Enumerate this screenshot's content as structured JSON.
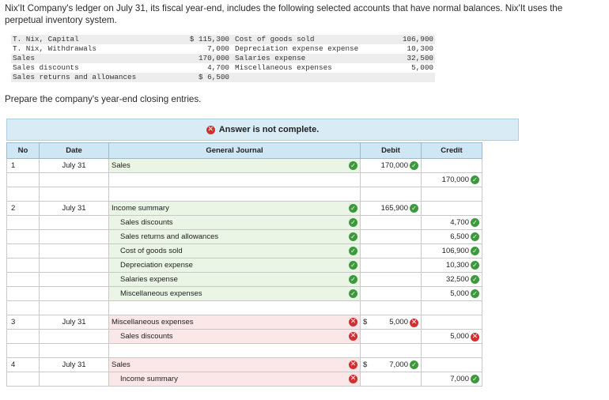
{
  "intro": "Nix'It Company's ledger on July 31, its fiscal year-end, includes the following selected accounts that have normal balances. Nix'It uses the perpetual inventory system.",
  "ledger": [
    {
      "a": "T. Nix, Capital",
      "b": "$ 115,300",
      "c": "Cost of goods sold",
      "d": "106,900"
    },
    {
      "a": "T. Nix, Withdrawals",
      "b": "7,000",
      "c": "Depreciation expense expense",
      "d": "10,300"
    },
    {
      "a": "Sales",
      "b": "170,000",
      "c": "Salaries expense",
      "d": "32,500"
    },
    {
      "a": "Sales discounts",
      "b": "4,700",
      "c": "Miscellaneous expenses",
      "d": "5,000"
    },
    {
      "a": "Sales returns and allowances",
      "b": "$ 6,500",
      "c": "",
      "d": ""
    }
  ],
  "prepare": "Prepare the company's year-end closing entries.",
  "banner": {
    "text": "Answer is not complete.",
    "icon": "x-circle-icon",
    "icon_color": "#d32f2f"
  },
  "headers": {
    "no": "No",
    "date": "Date",
    "journal": "General Journal",
    "debit": "Debit",
    "credit": "Credit"
  },
  "entries": [
    {
      "no": "1",
      "date": "July 31",
      "lines": [
        {
          "account": "Sales",
          "indent": false,
          "acct_status": "correct",
          "debit": "170,000",
          "debit_status": "correct",
          "dollar": false,
          "credit": "",
          "credit_status": ""
        },
        {
          "account": "",
          "indent": true,
          "acct_status": "",
          "debit": "",
          "debit_status": "",
          "dollar": false,
          "credit": "170,000",
          "credit_status": "correct"
        }
      ]
    },
    {
      "no": "2",
      "date": "July 31",
      "lines": [
        {
          "account": "Income summary",
          "indent": false,
          "acct_status": "correct",
          "debit": "165,900",
          "debit_status": "correct",
          "dollar": false,
          "credit": "",
          "credit_status": ""
        },
        {
          "account": "Sales discounts",
          "indent": true,
          "acct_status": "correct",
          "debit": "",
          "debit_status": "",
          "dollar": false,
          "credit": "4,700",
          "credit_status": "correct"
        },
        {
          "account": "Sales returns and allowances",
          "indent": true,
          "acct_status": "correct",
          "debit": "",
          "debit_status": "",
          "dollar": false,
          "credit": "6,500",
          "credit_status": "correct"
        },
        {
          "account": "Cost of goods sold",
          "indent": true,
          "acct_status": "correct",
          "debit": "",
          "debit_status": "",
          "dollar": false,
          "credit": "106,900",
          "credit_status": "correct"
        },
        {
          "account": "Depreciation expense",
          "indent": true,
          "acct_status": "correct",
          "debit": "",
          "debit_status": "",
          "dollar": false,
          "credit": "10,300",
          "credit_status": "correct"
        },
        {
          "account": "Salaries expense",
          "indent": true,
          "acct_status": "correct",
          "debit": "",
          "debit_status": "",
          "dollar": false,
          "credit": "32,500",
          "credit_status": "correct"
        },
        {
          "account": "Miscellaneous expenses",
          "indent": true,
          "acct_status": "correct",
          "debit": "",
          "debit_status": "",
          "dollar": false,
          "credit": "5,000",
          "credit_status": "correct"
        }
      ]
    },
    {
      "no": "3",
      "date": "July 31",
      "lines": [
        {
          "account": "Miscellaneous expenses",
          "indent": false,
          "acct_status": "incorrect",
          "debit": "5,000",
          "debit_status": "incorrect",
          "dollar": true,
          "credit": "",
          "credit_status": ""
        },
        {
          "account": "Sales discounts",
          "indent": true,
          "acct_status": "incorrect",
          "debit": "",
          "debit_status": "",
          "dollar": false,
          "credit": "5,000",
          "credit_status": "incorrect"
        }
      ]
    },
    {
      "no": "4",
      "date": "July 31",
      "lines": [
        {
          "account": "Sales",
          "indent": false,
          "acct_status": "incorrect",
          "debit": "7,000",
          "debit_status": "correct",
          "dollar": true,
          "credit": "",
          "credit_status": ""
        },
        {
          "account": "Income summary",
          "indent": true,
          "acct_status": "incorrect",
          "debit": "",
          "debit_status": "",
          "dollar": false,
          "credit": "7,000",
          "credit_status": "correct"
        }
      ]
    }
  ],
  "colors": {
    "correct": "#3c9a3c",
    "incorrect": "#d32f2f",
    "header_bg": "#cfe6f5",
    "banner_bg": "#d9ecf6"
  }
}
